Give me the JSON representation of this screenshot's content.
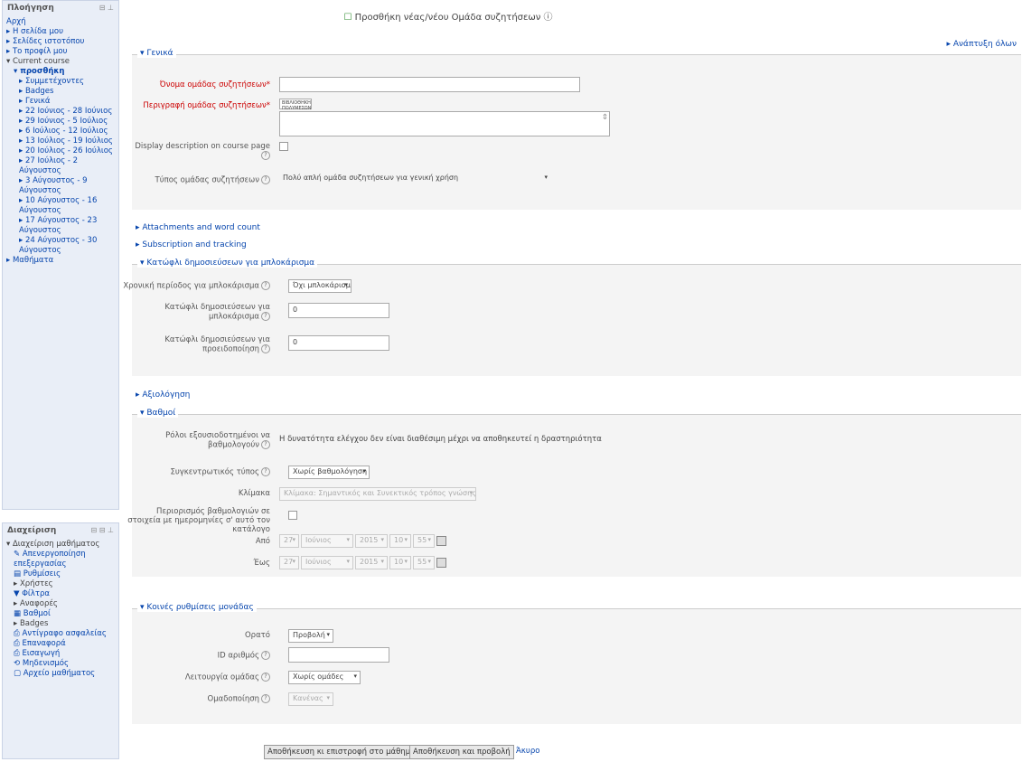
{
  "sidebar": {
    "nav_block": {
      "title": "Πλοήγηση",
      "ctrl": "⊟ ⊥",
      "items": [
        {
          "label": "Αρχή",
          "lvl": "lvl1"
        },
        {
          "label": "▸ Η σελίδα μου",
          "lvl": "lvl1"
        },
        {
          "label": "▸ Σελίδες ιστοτόπου",
          "lvl": "lvl1"
        },
        {
          "label": "▸ Το προφίλ μου",
          "lvl": "lvl1"
        },
        {
          "label": "▾ Current course",
          "lvl": "lvl1",
          "dark": true
        },
        {
          "label": "▾ προσθήκη",
          "lvl": "lvl2",
          "bold": true
        },
        {
          "label": "▸ Συμμετέχοντες",
          "lvl": "lvl3"
        },
        {
          "label": "▸ Badges",
          "lvl": "lvl3"
        },
        {
          "label": "▸ Γενικά",
          "lvl": "lvl3"
        },
        {
          "label": "▸ 22 Ιούνιος - 28 Ιούνιος",
          "lvl": "lvl3"
        },
        {
          "label": "▸ 29 Ιούνιος - 5 Ιούλιος",
          "lvl": "lvl3"
        },
        {
          "label": "▸ 6 Ιούλιος - 12 Ιούλιος",
          "lvl": "lvl3"
        },
        {
          "label": "▸ 13 Ιούλιος - 19 Ιούλιος",
          "lvl": "lvl3"
        },
        {
          "label": "▸ 20 Ιούλιος - 26 Ιούλιος",
          "lvl": "lvl3"
        },
        {
          "label": "▸ 27 Ιούλιος - 2 Αύγουστος",
          "lvl": "lvl3"
        },
        {
          "label": "▸ 3 Αύγουστος - 9 Αύγουστος",
          "lvl": "lvl3"
        },
        {
          "label": "▸ 10 Αύγουστος - 16 Αύγουστος",
          "lvl": "lvl3"
        },
        {
          "label": "▸ 17 Αύγουστος - 23 Αύγουστος",
          "lvl": "lvl3"
        },
        {
          "label": "▸ 24 Αύγουστος - 30 Αύγουστος",
          "lvl": "lvl3"
        },
        {
          "label": "▸ Μαθήματα",
          "lvl": "lvl1"
        }
      ]
    },
    "admin_block": {
      "title": "Διαχείριση",
      "ctrl": "⊟ ⊟ ⊥",
      "items": [
        {
          "label": "▾ Διαχείριση μαθήματος",
          "lvl": "lvl1",
          "dark": true
        },
        {
          "label": "✎ Απενεργοποίηση επεξεργασίας",
          "lvl": "lvl2"
        },
        {
          "label": "▤ Ρυθμίσεις",
          "lvl": "lvl2"
        },
        {
          "label": "▸ Χρήστες",
          "lvl": "lvl2",
          "dark": true
        },
        {
          "label": "▼ Φίλτρα",
          "lvl": "lvl2"
        },
        {
          "label": "▸ Αναφορές",
          "lvl": "lvl2",
          "dark": true
        },
        {
          "label": "▦ Βαθμοί",
          "lvl": "lvl2"
        },
        {
          "label": "▸ Badges",
          "lvl": "lvl2",
          "dark": true
        },
        {
          "label": "⎙ Αντίγραφο ασφαλείας",
          "lvl": "lvl2"
        },
        {
          "label": "⎙ Επαναφορά",
          "lvl": "lvl2"
        },
        {
          "label": "⎙ Εισαγωγή",
          "lvl": "lvl2"
        },
        {
          "label": "⟲ Μηδενισμός",
          "lvl": "lvl2"
        },
        {
          "label": "▢ Αρχείο μαθήματος",
          "lvl": "lvl2"
        }
      ]
    }
  },
  "header": {
    "title": "Προσθήκη νέας/νέου Ομάδα συζητήσεων",
    "expand_all": "▸ Ανάπτυξη όλων"
  },
  "general": {
    "legend": "▾ Γενικά",
    "name_label": "Όνομα ομάδας συζητήσεων*",
    "desc_label": "Περιγραφή ομάδας συζητήσεων*",
    "editor_toolbar": "ΒΙΒΛΙΟΘΗΚΗ ΠΟΛΥΜΕΣΩΝ",
    "display_desc_label": "Display description on course page",
    "type_label": "Τύπος ομάδας συζητήσεων",
    "type_value": "Πολύ απλή ομάδα συζητήσεων για γενική χρήση"
  },
  "collapsed": {
    "attachments": "▸ Attachments and word count",
    "subscription": "▸ Subscription and tracking"
  },
  "blocking": {
    "legend": "▾ Κατώφλι δημοσιεύσεων για μπλοκάρισμα",
    "period_label": "Χρονική περίοδος για μπλοκάρισμα",
    "period_value": "Όχι μπλοκάρισμα",
    "block_label": "Κατώφλι δημοσιεύσεων για μπλοκάρισμα",
    "block_value": "0",
    "warn_label": "Κατώφλι δημοσιεύσεων για προειδοποίηση",
    "warn_value": "0"
  },
  "ratings_collapsed": "▸ Αξιολόγηση",
  "ratings": {
    "legend": "▾ Βαθμοί",
    "roles_label": "Ρόλοι εξουσιοδοτημένοι να βαθμολογούν",
    "roles_value": "Η δυνατότητα ελέγχου δεν είναι διαθέσιμη μέχρι να αποθηκευτεί η δραστηριότητα",
    "agg_label": "Συγκεντρωτικός τύπος",
    "agg_value": "Χωρίς βαθμολόγηση",
    "scale_label": "Κλίμακα",
    "scale_value": "Κλίμακα: Σημαντικός και Συνεκτικός τρόπος γνώσης",
    "restrict_label": "Περιορισμός βαθμολογιών σε στοιχεία με ημερομηνίες σ' αυτό τον κατάλογο",
    "from_label": "Από",
    "to_label": "Έως",
    "from": [
      "27",
      "Ιούνιος",
      "2015",
      "10",
      "55"
    ],
    "to": [
      "27",
      "Ιούνιος",
      "2015",
      "10",
      "55"
    ]
  },
  "common": {
    "legend": "▾ Κοινές ρυθμίσεις μονάδας",
    "visible_label": "Ορατό",
    "visible_value": "Προβολή",
    "id_label": "ID αριθμός",
    "id_value": "",
    "group_mode_label": "Λειτουργία ομάδας",
    "group_mode_value": "Χωρίς ομάδες",
    "grouping_label": "Ομαδοποίηση",
    "grouping_value": "Κανένας"
  },
  "buttons": {
    "save_return": "Αποθήκευση κι επιστροφή στο μάθημα",
    "save_display": "Αποθήκευση και προβολή",
    "cancel": "Άκυρο"
  }
}
